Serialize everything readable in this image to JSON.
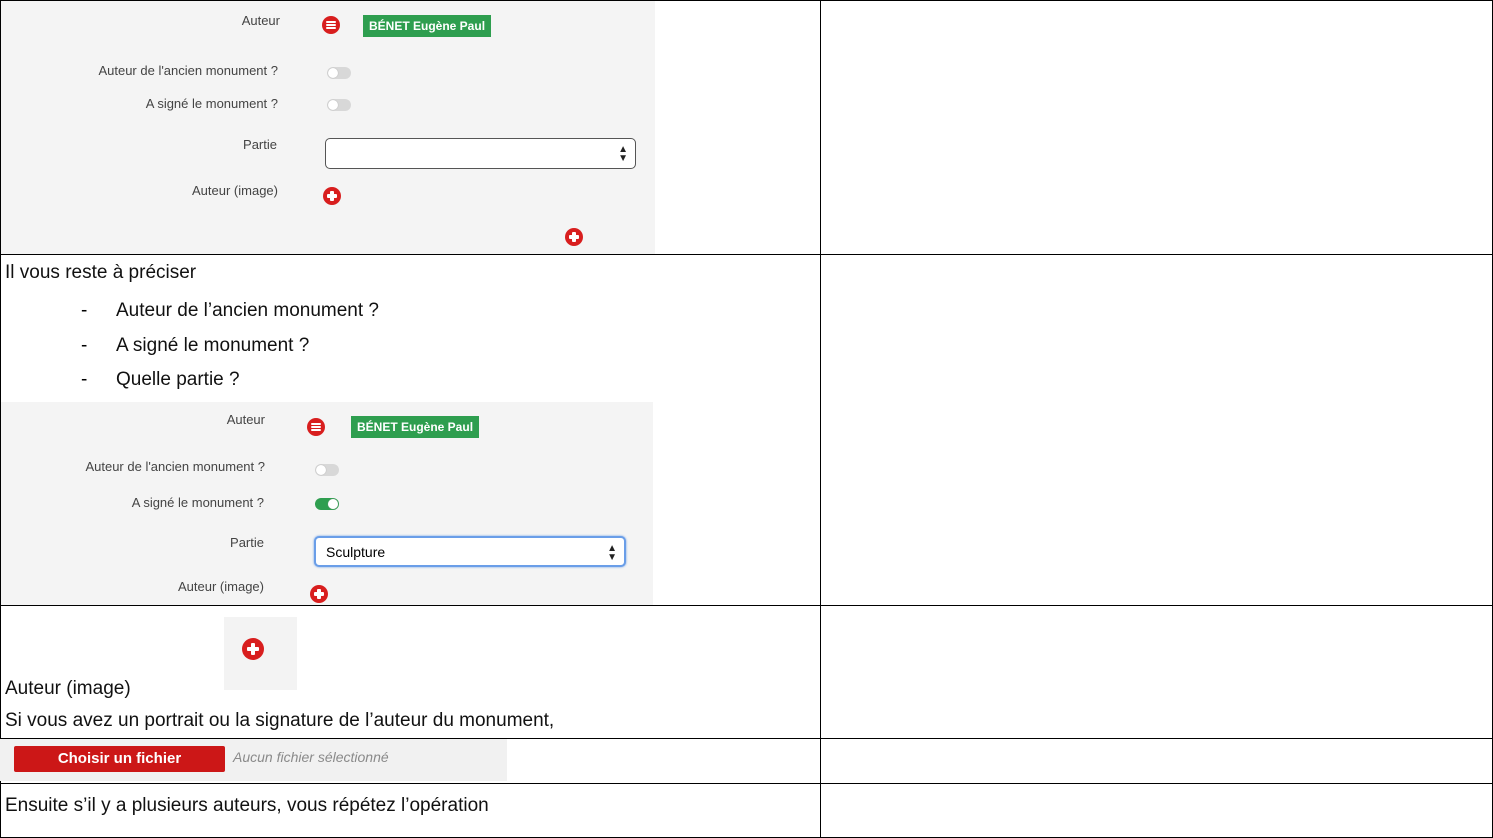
{
  "panel1": {
    "auteur_label": "Auteur",
    "auteur_tag": "BÉNET Eugène Paul",
    "ancien_label": "Auteur de l'ancien monument ?",
    "signe_label": "A signé le monument ?",
    "partie_label": "Partie",
    "partie_value": "",
    "image_label": "Auteur (image)",
    "toggle_ancien_on": false,
    "toggle_signe_on": false
  },
  "instructions": {
    "intro": "Il vous reste à préciser",
    "bullets": [
      "Auteur de l’ancien monument ?",
      "A signé le monument ?",
      "Quelle partie ?"
    ],
    "dash": "-"
  },
  "panel2": {
    "auteur_label": "Auteur",
    "auteur_tag": "BÉNET Eugène Paul",
    "ancien_label": "Auteur de l'ancien monument ?",
    "signe_label": "A signé le monument ?",
    "partie_label": "Partie",
    "partie_value": "Sculpture",
    "image_label": "Auteur (image)",
    "toggle_ancien_on": false,
    "toggle_signe_on": true
  },
  "image_section": {
    "label": "Auteur (image)",
    "description": "Si vous avez un portrait ou la signature de l’auteur du monument,"
  },
  "file_input": {
    "button_label": "Choisir un fichier",
    "status": "Aucun fichier sélectionné"
  },
  "footer_text": "Ensuite s’il y a plusieurs auteurs, vous répétez l’opération",
  "colors": {
    "accent_red": "#d81e1e",
    "tag_green": "#2e9e4f",
    "focus_blue": "#6a9ee8"
  },
  "icons": [
    "minus-circle-icon",
    "plus-circle-icon",
    "select-arrows-icon"
  ]
}
